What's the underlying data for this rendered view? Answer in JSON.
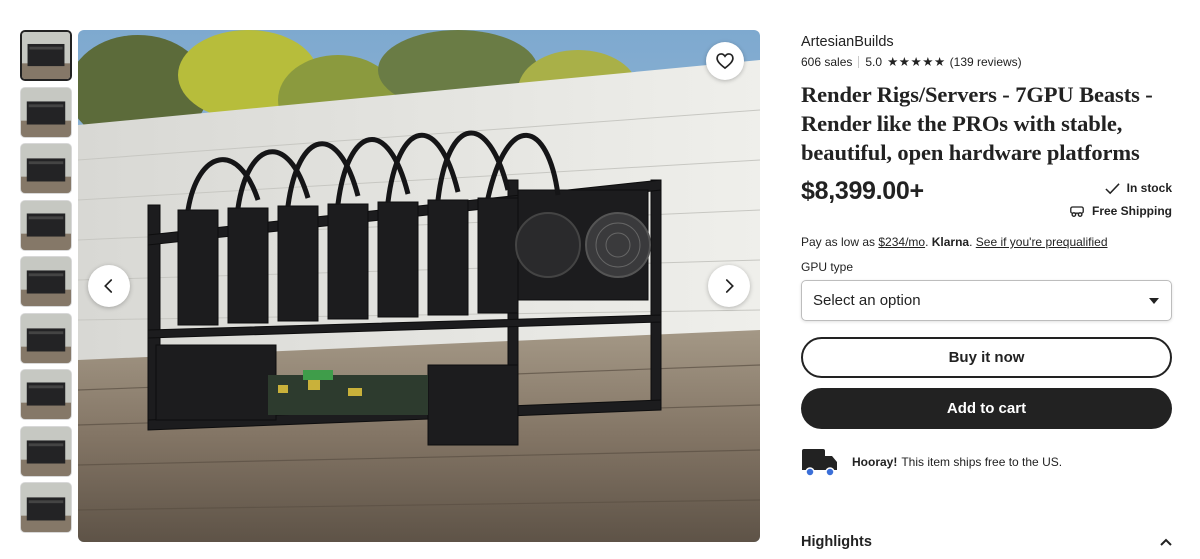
{
  "gallery": {
    "thumbnail_count": 9,
    "active_index": 0,
    "favorite_icon": "heart-icon",
    "prev_icon": "chevron-left-icon",
    "next_icon": "chevron-right-icon"
  },
  "listing": {
    "shop_name": "ArtesianBuilds",
    "sales": "606 sales",
    "rating": "5.0",
    "stars": 5,
    "reviews": "(139 reviews)",
    "title": "Render Rigs/Servers - 7GPU Beasts - Render like the PROs with stable, beautiful, open hardware platforms",
    "price": "$8,399.00+",
    "stock": "In stock",
    "shipping": "Free Shipping",
    "financing": {
      "prefix": "Pay as low as ",
      "monthly": "$234/mo",
      "dot": ". ",
      "provider": "Klarna",
      "dot2": ". ",
      "prequalify": "See if you're prequalified"
    },
    "variation_label": "GPU type",
    "variation_placeholder": "Select an option",
    "buy_now": "Buy it now",
    "add_to_cart": "Add to cart",
    "ship_note_strong": "Hooray!",
    "ship_note": "This item ships free to the US.",
    "highlights": "Highlights"
  },
  "colors": {
    "text": "#222222",
    "button_dark": "#222222",
    "sky": "#8fb7d9",
    "deck": "#7a6d5d"
  }
}
